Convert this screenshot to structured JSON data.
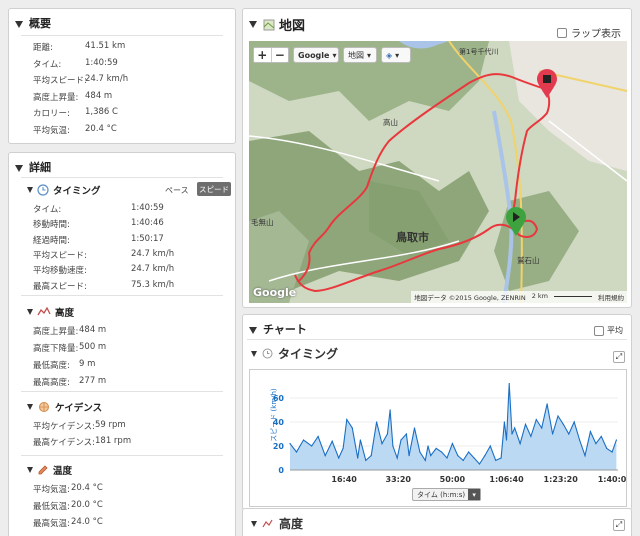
{
  "summary": {
    "title": "概要",
    "rows": [
      {
        "label": "距離:",
        "value": "41.51 km"
      },
      {
        "label": "タイム:",
        "value": "1:40:59"
      },
      {
        "label": "平均スピード:",
        "value": "24.7 km/h"
      },
      {
        "label": "高度上昇量:",
        "value": "484 m"
      },
      {
        "label": "カロリー:",
        "value": "1,386 C"
      },
      {
        "label": "平均気温:",
        "value": "20.4 °C"
      }
    ]
  },
  "details": {
    "title": "詳細",
    "timing": {
      "title": "タイミング",
      "pace_label": "ペース",
      "speed_label": "スピード",
      "rows": [
        {
          "label": "タイム:",
          "value": "1:40:59"
        },
        {
          "label": "移動時間:",
          "value": "1:40:46"
        },
        {
          "label": "経過時間:",
          "value": "1:50:17"
        },
        {
          "label": "平均スピード:",
          "value": "24.7 km/h"
        },
        {
          "label": "平均移動速度:",
          "value": "24.7 km/h"
        },
        {
          "label": "最高スピード:",
          "value": "75.3 km/h"
        }
      ]
    },
    "elevation": {
      "title": "高度",
      "rows": [
        {
          "label": "高度上昇量:",
          "value": "484 m"
        },
        {
          "label": "高度下降量:",
          "value": "500 m"
        },
        {
          "label": "最低高度:",
          "value": "9 m"
        },
        {
          "label": "最高高度:",
          "value": "277 m"
        }
      ]
    },
    "cadence": {
      "title": "ケイデンス",
      "rows": [
        {
          "label": "平均ケイデンス:",
          "value": "59 rpm"
        },
        {
          "label": "最高ケイデンス:",
          "value": "181 rpm"
        }
      ]
    },
    "temperature": {
      "title": "温度",
      "rows": [
        {
          "label": "平均気温:",
          "value": "20.4 °C"
        },
        {
          "label": "最低気温:",
          "value": "20.0 °C"
        },
        {
          "label": "最高気温:",
          "value": "24.0 °C"
        }
      ]
    }
  },
  "map": {
    "title": "地図",
    "lap_toggle": "ラップ表示",
    "provider": "Google",
    "type": "地図",
    "city_label": "鳥取市",
    "mountain1": "高山",
    "mountain2": "鷲石山",
    "place1": "毛無山",
    "highway": "第1号千代川",
    "attribution": "地図データ ©2015 Google, ZENRIN",
    "scale": "2 km",
    "terms": "利用規約",
    "logo": "Google",
    "route_color": "#e8383d"
  },
  "chart": {
    "title": "チャート",
    "avg_label": "平均",
    "timing_title": "タイミング",
    "ylabel": "スピード (km/h)",
    "xaxis_button": "タイム (h:m:s)",
    "next_title": "高度"
  },
  "chart_data": {
    "type": "area",
    "ylabel": "スピード (km/h)",
    "xlabel": "タイム (h:m:s)",
    "xticks": [
      "16:40",
      "33:20",
      "50:00",
      "1:06:40",
      "1:23:20",
      "1:40:00"
    ],
    "yticks": [
      0,
      20,
      40,
      60
    ],
    "ylim": [
      0,
      75
    ],
    "xlim_seconds": [
      0,
      6059
    ],
    "x_seconds": [
      0,
      120,
      250,
      400,
      520,
      650,
      780,
      900,
      980,
      1050,
      1150,
      1250,
      1300,
      1400,
      1500,
      1600,
      1700,
      1800,
      1850,
      1900,
      1980,
      2050,
      2150,
      2200,
      2300,
      2400,
      2500,
      2550,
      2600,
      2700,
      2800,
      2900,
      3000,
      3100,
      3200,
      3300,
      3400,
      3500,
      3600,
      3700,
      3800,
      3900,
      3960,
      4000,
      4050,
      4100,
      4150,
      4250,
      4350,
      4450,
      4550,
      4650,
      4750,
      4850,
      4950,
      5050,
      5150,
      5250,
      5350,
      5450,
      5550,
      5650,
      5750,
      5850,
      5950,
      6030
    ],
    "values": [
      22,
      15,
      25,
      20,
      28,
      12,
      24,
      10,
      18,
      42,
      35,
      10,
      25,
      8,
      12,
      40,
      22,
      30,
      50,
      20,
      10,
      25,
      30,
      12,
      35,
      15,
      8,
      20,
      12,
      18,
      15,
      10,
      22,
      12,
      8,
      15,
      10,
      5,
      12,
      20,
      8,
      10,
      40,
      25,
      72,
      30,
      35,
      22,
      38,
      28,
      42,
      35,
      55,
      30,
      45,
      38,
      30,
      40,
      25,
      12,
      32,
      22,
      28,
      18,
      15,
      25
    ],
    "fill_color": "#bcd9f3",
    "line_color": "#1a6fc4"
  }
}
